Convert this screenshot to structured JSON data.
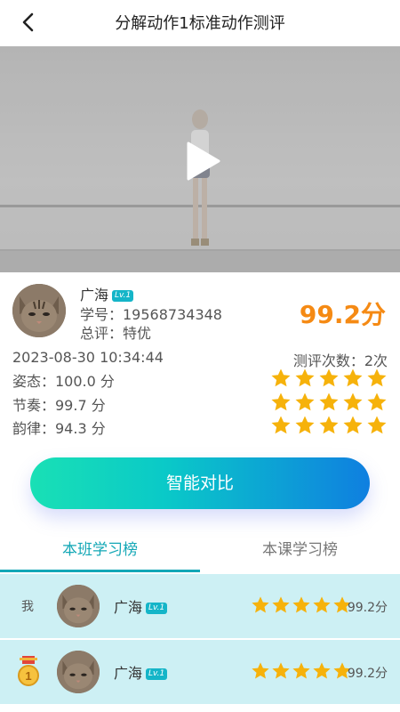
{
  "header": {
    "title": "分解动作1标准动作测评"
  },
  "video": {
    "play_icon": "play-icon"
  },
  "profile": {
    "name": "广海",
    "level": "Lv.1",
    "student_id": "学号：19568734348",
    "overall": "总评：特优",
    "score": "99.2分"
  },
  "meta": {
    "datetime": "2023-08-30 10:34:44",
    "eval_count": "测评次数：2次"
  },
  "metrics": [
    {
      "label": "姿态：100.0 分",
      "stars": 5
    },
    {
      "label": "节奏：99.7 分",
      "stars": 5
    },
    {
      "label": "韵律：94.3 分",
      "stars": 5
    }
  ],
  "compare_button": "智能对比",
  "tabs": [
    {
      "label": "本班学习榜",
      "active": true
    },
    {
      "label": "本课学习榜",
      "active": false
    }
  ],
  "leaderboard": [
    {
      "tag": "我",
      "name": "广海",
      "level": "Lv.1",
      "stars": 5,
      "score": "99.2分"
    },
    {
      "rank": "1",
      "name": "广海",
      "level": "Lv.1",
      "stars": 5,
      "score": "99.2分"
    }
  ],
  "colors": {
    "accent": "#13a7b6",
    "score": "#f58a14",
    "star": "#f6b20b",
    "row_bg": "#cdf0f4"
  }
}
